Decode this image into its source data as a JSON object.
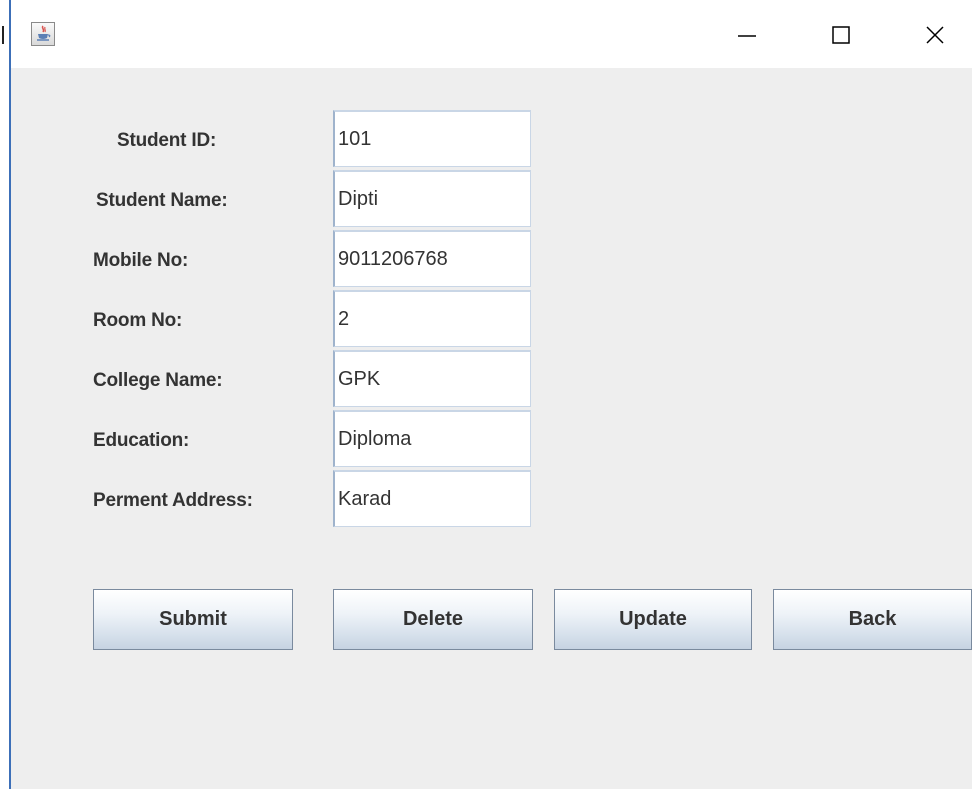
{
  "window": {
    "icons": {
      "app": "java-cup-icon",
      "minimize": "minimize-icon",
      "maximize": "maximize-icon",
      "close": "close-icon"
    }
  },
  "form": {
    "fields": [
      {
        "key": "student_id",
        "label": "Student ID:",
        "value": "101"
      },
      {
        "key": "student_name",
        "label": "Student Name:",
        "value": "Dipti"
      },
      {
        "key": "mobile_no",
        "label": "Mobile No:",
        "value": "9011206768"
      },
      {
        "key": "room_no",
        "label": "Room No:",
        "value": "2"
      },
      {
        "key": "college_name",
        "label": "College Name:",
        "value": "GPK"
      },
      {
        "key": "education",
        "label": "Education:",
        "value": "Diploma"
      },
      {
        "key": "perment_address",
        "label": "Perment Address:",
        "value": "Karad"
      }
    ]
  },
  "buttons": {
    "submit": "Submit",
    "delete": "Delete",
    "update": "Update",
    "back": "Back"
  },
  "colors": {
    "content_bg": "#eeeeee",
    "window_edge": "#3c6fb8",
    "label_text": "#333333"
  }
}
